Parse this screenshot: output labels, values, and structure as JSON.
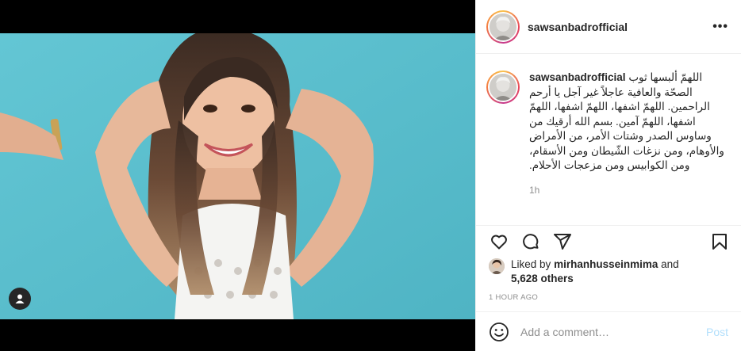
{
  "post": {
    "username": "sawsanbadrofficial",
    "more_icon": "more-horizontal-icon",
    "more_label": "•••",
    "tag_icon": "user-tag-icon"
  },
  "caption": {
    "username": "sawsanbadrofficial",
    "text": "اللهمّ ألبسها ثوب الصحّة والعافية عاجلاً غير آجل يا أرحم الراحمين. اللهمّ اشفها، اللهمّ اشفها، اللهمّ اشفها، اللهمّ آمين. بسم الله أرقيك من وساوس الصدر وشتات الأمر، من الأمراض والأوهام، ومن نزغات الشّيطان ومن الأسقام، ومن الكوابيس ومن مزعجات الأحلام.",
    "time": "1h"
  },
  "actions": {
    "like_icon": "heart-icon",
    "comment_icon": "comment-icon",
    "share_icon": "share-icon",
    "save_icon": "bookmark-icon"
  },
  "likes": {
    "prefix": "Liked by",
    "user": "mirhanhusseinmima",
    "middle": "and",
    "others": "5,628 others"
  },
  "timestamp": "1 HOUR AGO",
  "comment": {
    "emoji_icon": "smiley-icon",
    "placeholder": "Add a comment…",
    "post_label": "Post"
  },
  "colors": {
    "photo_background": "#5bc0cf",
    "post_button": "#b2dffc",
    "secondary_text": "#8e8e8e"
  }
}
